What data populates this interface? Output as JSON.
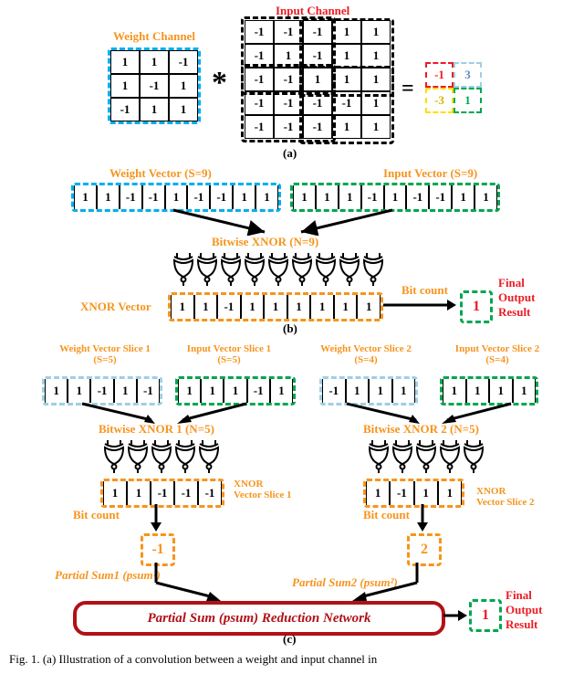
{
  "labels": {
    "input_channel": "Input Channel",
    "weight_channel": "Weight Channel",
    "result_box_tl": "-1",
    "result_box_tr": "3",
    "result_box_bl": "-3",
    "result_box_br": "1",
    "part_a": "(a)",
    "part_b": "(b)",
    "part_c": "(c)",
    "weight_vec9": "Weight Vector (S=9)",
    "input_vec9": "Input Vector (S=9)",
    "bitwise_xnor9": "Bitwise XNOR (N=9)",
    "xnor_vector": "XNOR Vector",
    "bitcount_b": "Bit count",
    "final_out_line1": "Final",
    "final_out_line2": "Output",
    "final_out_line3": "Result",
    "final_val_b": "1",
    "wv1": "Weight Vector Slice 1\n(S=5)",
    "iv1": "Input Vector Slice 1\n(S=5)",
    "wv2": "Weight Vector Slice 2\n(S=4)",
    "iv2": "Input Vector Slice 2\n(S=4)",
    "bx1": "Bitwise XNOR 1 (N=5)",
    "bx2": "Bitwise  XNOR 2 (N=5)",
    "xnor_slice1": "XNOR\nVector Slice 1",
    "xnor_slice2": "XNOR\nVector Slice 2",
    "bitcount_c": "Bit count",
    "psum1_label": "Partial Sum1 (psum¹)",
    "psum2_label": "Partial Sum2 (psum²)",
    "psum1_val": "-1",
    "psum2_val": "2",
    "reduce_text": "Partial Sum (psum) Reduction Network",
    "final_val_c": "1"
  },
  "a_weight": [
    "1",
    "1",
    "-1",
    "1",
    "-1",
    "1",
    "-1",
    "1",
    "1"
  ],
  "a_input": [
    "-1",
    "-1",
    "-1",
    "1",
    "1",
    "-1",
    "1",
    "-1",
    "1",
    "1",
    "-1",
    "-1",
    "1",
    "1",
    "1",
    "-1",
    "-1",
    "-1",
    "-1",
    "1",
    "-1",
    "-1",
    "-1",
    "1",
    "1"
  ],
  "b_weight": [
    "1",
    "1",
    "-1",
    "-1",
    "1",
    "-1",
    "-1",
    "1",
    "1"
  ],
  "b_input": [
    "1",
    "1",
    "1",
    "-1",
    "1",
    "-1",
    "-1",
    "1",
    "1"
  ],
  "b_xnor": [
    "1",
    "1",
    "-1",
    "1",
    "1",
    "1",
    "1",
    "1",
    "1"
  ],
  "c_w1": [
    "1",
    "1",
    "-1",
    "1",
    "-1"
  ],
  "c_i1": [
    "1",
    "1",
    "1",
    "-1",
    "1"
  ],
  "c_w2": [
    "-1",
    "1",
    "1",
    "1"
  ],
  "c_i2": [
    "1",
    "1",
    "1",
    "1"
  ],
  "c_x1": [
    "1",
    "1",
    "-1",
    "-1",
    "-1"
  ],
  "c_x2": [
    "1",
    "-1",
    "1",
    "1"
  ],
  "caption": "Fig. 1.  (a) Illustration of a convolution between a weight and input channel in"
}
